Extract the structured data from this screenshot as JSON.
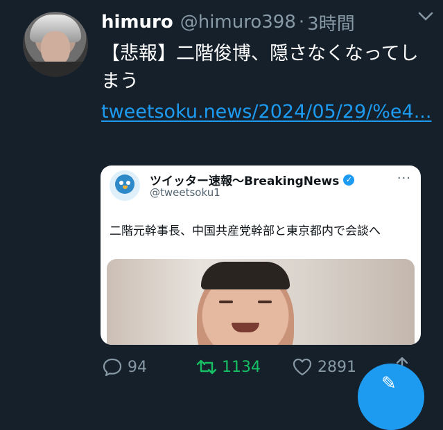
{
  "tweet": {
    "display_name": "himuro",
    "handle": "@himuro398",
    "separator": "·",
    "time": "3時間",
    "text": "【悲報】二階俊博、隠さなくなってしまう",
    "link_text": "tweetsoku.news/2024/05/29/%e4..."
  },
  "quoted": {
    "display_name": "ツイッター速報〜BreakingNews",
    "handle": "@tweetsoku1",
    "more": "···",
    "text": "二階元幹事長、中国共産党幹部と東京都内で会談へ"
  },
  "actions": {
    "replies": "94",
    "retweets": "1134",
    "likes": "2891"
  },
  "colors": {
    "background": "#15202b",
    "secondary_text": "#8899a6",
    "link": "#1d9bf0",
    "retweet_active": "#17bf63"
  },
  "icons": [
    "chevron-down-icon",
    "verified-badge-icon",
    "reply-icon",
    "retweet-icon",
    "like-icon",
    "share-icon",
    "compose-icon"
  ]
}
